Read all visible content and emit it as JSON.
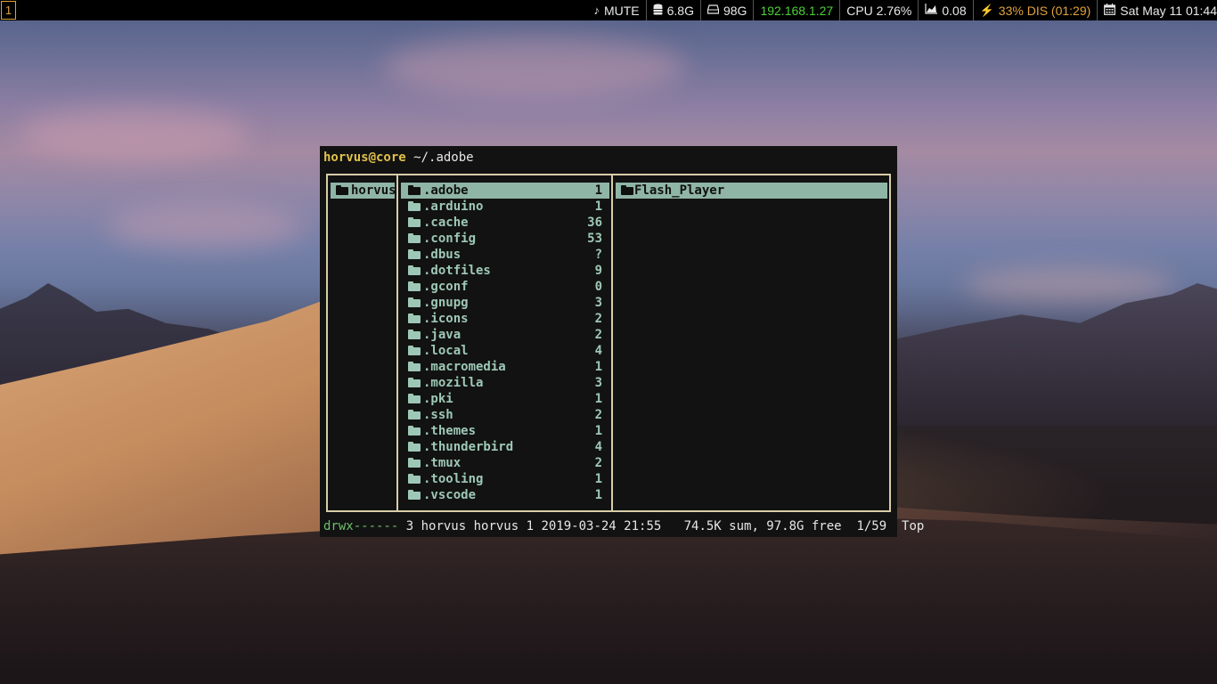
{
  "topbar": {
    "workspace": "1",
    "volume": {
      "icon": "music-note-icon",
      "text": "MUTE"
    },
    "memory": {
      "icon": "database-icon",
      "text": "6.8G"
    },
    "disk": {
      "icon": "hard-drive-icon",
      "text": "98G"
    },
    "network": {
      "text": "192.168.1.27",
      "color": "#4cd137"
    },
    "cpu": {
      "text": "CPU 2.76%"
    },
    "load": {
      "icon": "area-chart-icon",
      "text": "0.08"
    },
    "battery": {
      "icon": "bolt-icon",
      "text": "33% DIS (01:29)",
      "color": "#e0a33a"
    },
    "clock": {
      "icon": "calendar-icon",
      "text": "Sat May 11 01:44"
    }
  },
  "terminal": {
    "prompt_user": "horvus@core",
    "prompt_path": "~/.adobe",
    "parent_pane": [
      {
        "name": "horvus",
        "selected": true
      }
    ],
    "current_pane": [
      {
        "name": ".adobe",
        "count": "1",
        "selected": true
      },
      {
        "name": ".arduino",
        "count": "1"
      },
      {
        "name": ".cache",
        "count": "36"
      },
      {
        "name": ".config",
        "count": "53"
      },
      {
        "name": ".dbus",
        "count": "?"
      },
      {
        "name": ".dotfiles",
        "count": "9"
      },
      {
        "name": ".gconf",
        "count": "0"
      },
      {
        "name": ".gnupg",
        "count": "3"
      },
      {
        "name": ".icons",
        "count": "2"
      },
      {
        "name": ".java",
        "count": "2"
      },
      {
        "name": ".local",
        "count": "4"
      },
      {
        "name": ".macromedia",
        "count": "1"
      },
      {
        "name": ".mozilla",
        "count": "3"
      },
      {
        "name": ".pki",
        "count": "1"
      },
      {
        "name": ".ssh",
        "count": "2"
      },
      {
        "name": ".themes",
        "count": "1"
      },
      {
        "name": ".thunderbird",
        "count": "4"
      },
      {
        "name": ".tmux",
        "count": "2"
      },
      {
        "name": ".tooling",
        "count": "1"
      },
      {
        "name": ".vscode",
        "count": "1"
      }
    ],
    "preview_pane": [
      {
        "name": "Flash_Player",
        "selected": true
      }
    ],
    "status": {
      "permissions": "drwx------",
      "info": " 3 horvus horvus 1 2019-03-24 21:55   74.5K sum, 97.8G free  1/59  Top"
    },
    "colors": {
      "dir": "#9ec8b6",
      "selected_bg": "#8fb5a6",
      "border": "#d8cda8",
      "user": "#e0c24a"
    }
  }
}
